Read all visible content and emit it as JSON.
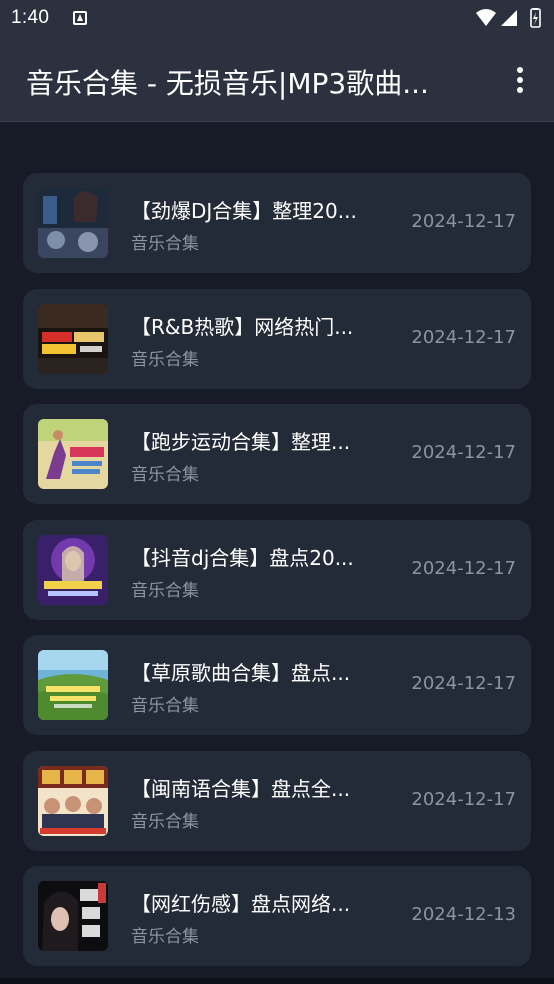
{
  "status_bar": {
    "time": "1:40"
  },
  "app_bar": {
    "title": "音乐合集 - 无损音乐|MP3歌曲...",
    "menu_icon": "more-vert-icon"
  },
  "items": [
    {
      "title": "【劲爆DJ合集】整理20...",
      "category": "音乐合集",
      "date": "2024-12-17",
      "thumb_icon": "dj-mixer-photo"
    },
    {
      "title": "【R&B热歌】网络热门...",
      "category": "音乐合集",
      "date": "2024-12-17",
      "thumb_icon": "rnb-album-cover"
    },
    {
      "title": "【跑步运动合集】整理...",
      "category": "音乐合集",
      "date": "2024-12-17",
      "thumb_icon": "running-album-cover"
    },
    {
      "title": "【抖音dj合集】盘点20...",
      "category": "音乐合集",
      "date": "2024-12-17",
      "thumb_icon": "douyin-dj-cover"
    },
    {
      "title": "【草原歌曲合集】盘点...",
      "category": "音乐合集",
      "date": "2024-12-17",
      "thumb_icon": "grassland-cover"
    },
    {
      "title": "【闽南语合集】盘点全...",
      "category": "音乐合集",
      "date": "2024-12-17",
      "thumb_icon": "minnan-cover"
    },
    {
      "title": "【网红伤感】盘点网络...",
      "category": "音乐合集",
      "date": "2024-12-13",
      "thumb_icon": "sad-songs-cover"
    }
  ],
  "colors": {
    "background": "#161b27",
    "app_bar": "#2c3140",
    "card": "#232a38",
    "secondary_text": "#8c93a3"
  }
}
